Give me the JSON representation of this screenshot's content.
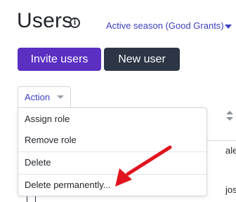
{
  "header": {
    "title": "Users",
    "info_icon": "info-icon",
    "season_label": "Active season (Good Grants)"
  },
  "toolbar": {
    "invite_label": "Invite users",
    "new_user_label": "New user",
    "action_label": "Action"
  },
  "action_menu": {
    "items": [
      {
        "label": "Assign role"
      },
      {
        "label": "Remove role"
      },
      {
        "label": "Delete"
      },
      {
        "label": "Delete permanently..."
      }
    ]
  },
  "table": {
    "rows": [
      {
        "cell": "ale"
      },
      {
        "cell": "jos"
      }
    ]
  },
  "colors": {
    "primary_button": "#5a2fc2",
    "secondary_button": "#2c3645",
    "link": "#3b3fbf",
    "annotation_arrow": "#e0141e"
  }
}
